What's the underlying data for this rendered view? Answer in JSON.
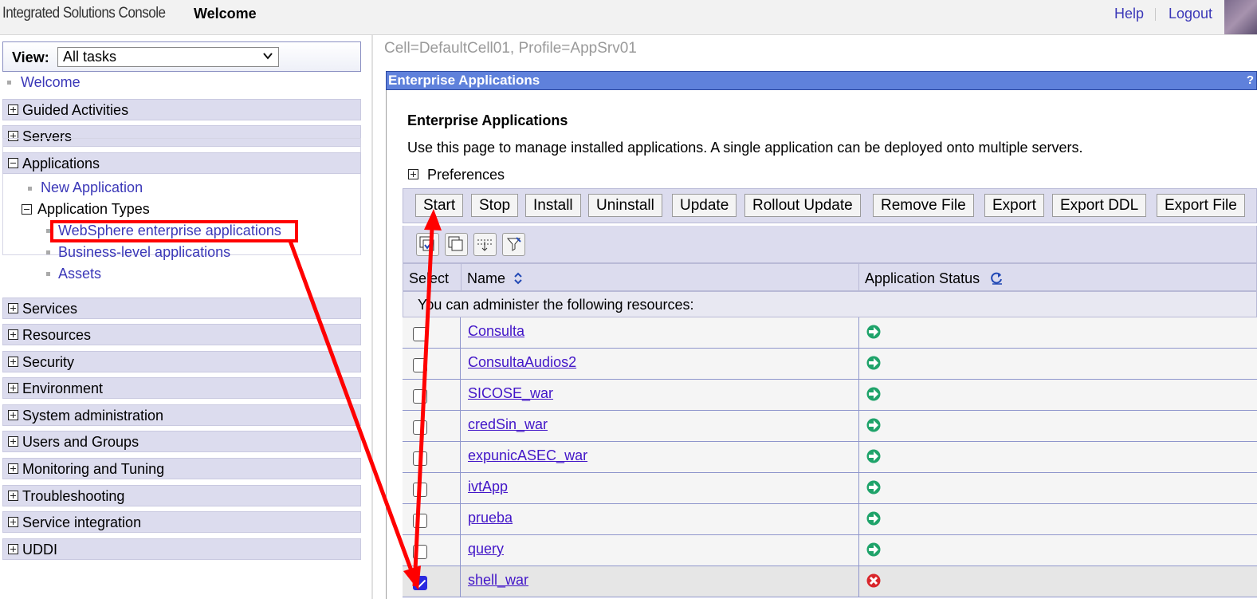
{
  "header": {
    "brand": "Integrated Solutions Console",
    "title": "Welcome",
    "help": "Help",
    "logout": "Logout"
  },
  "nav": {
    "view_label": "View:",
    "view_value": "All tasks",
    "welcome": "Welcome",
    "categories_top": [
      "Guided Activities",
      "Servers"
    ],
    "applications": {
      "label": "Applications",
      "new_application": "New Application",
      "application_types": "Application Types",
      "types": [
        "WebSphere enterprise applications",
        "Business-level applications",
        "Assets"
      ]
    },
    "categories_bottom": [
      "Services",
      "Resources",
      "Security",
      "Environment",
      "System administration",
      "Users and Groups",
      "Monitoring and Tuning",
      "Troubleshooting",
      "Service integration",
      "UDDI"
    ]
  },
  "main": {
    "scope": "Cell=DefaultCell01, Profile=AppSrv01",
    "portlet_title": "Enterprise Applications",
    "portlet_help": "?",
    "page_title": "Enterprise Applications",
    "description": "Use this page to manage installed applications. A single application can be deployed onto multiple servers.",
    "preferences": "Preferences",
    "buttons": [
      "Start",
      "Stop",
      "Install",
      "Uninstall",
      "Update",
      "Rollout Update",
      "Remove File",
      "Export",
      "Export DDL",
      "Export File"
    ],
    "icon_buttons": [
      "select-all-icon",
      "deselect-all-icon",
      "expand-filter-icon",
      "clear-filter-icon"
    ],
    "table": {
      "col_select": "Select",
      "col_name": "Name",
      "col_status": "Application Status",
      "resources_note": "You can administer the following resources:",
      "rows": [
        {
          "name": "Consulta",
          "status": "started",
          "checked": false
        },
        {
          "name": "ConsultaAudios2",
          "status": "started",
          "checked": false
        },
        {
          "name": "SICOSE_war",
          "status": "started",
          "checked": false
        },
        {
          "name": "credSin_war",
          "status": "started",
          "checked": false
        },
        {
          "name": "expunicASEC_war",
          "status": "started",
          "checked": false
        },
        {
          "name": "ivtApp",
          "status": "started",
          "checked": false
        },
        {
          "name": "prueba",
          "status": "started",
          "checked": false
        },
        {
          "name": "query",
          "status": "started",
          "checked": false
        },
        {
          "name": "shell_war",
          "status": "stopped",
          "checked": true
        }
      ]
    }
  },
  "colors": {
    "link": "#3b38b8",
    "portlet_bar": "#5f81db",
    "nav_category": "#dcdcee",
    "annotation_red": "#ff0000",
    "status_started": "#1fa36a",
    "status_stopped": "#d9262b"
  }
}
